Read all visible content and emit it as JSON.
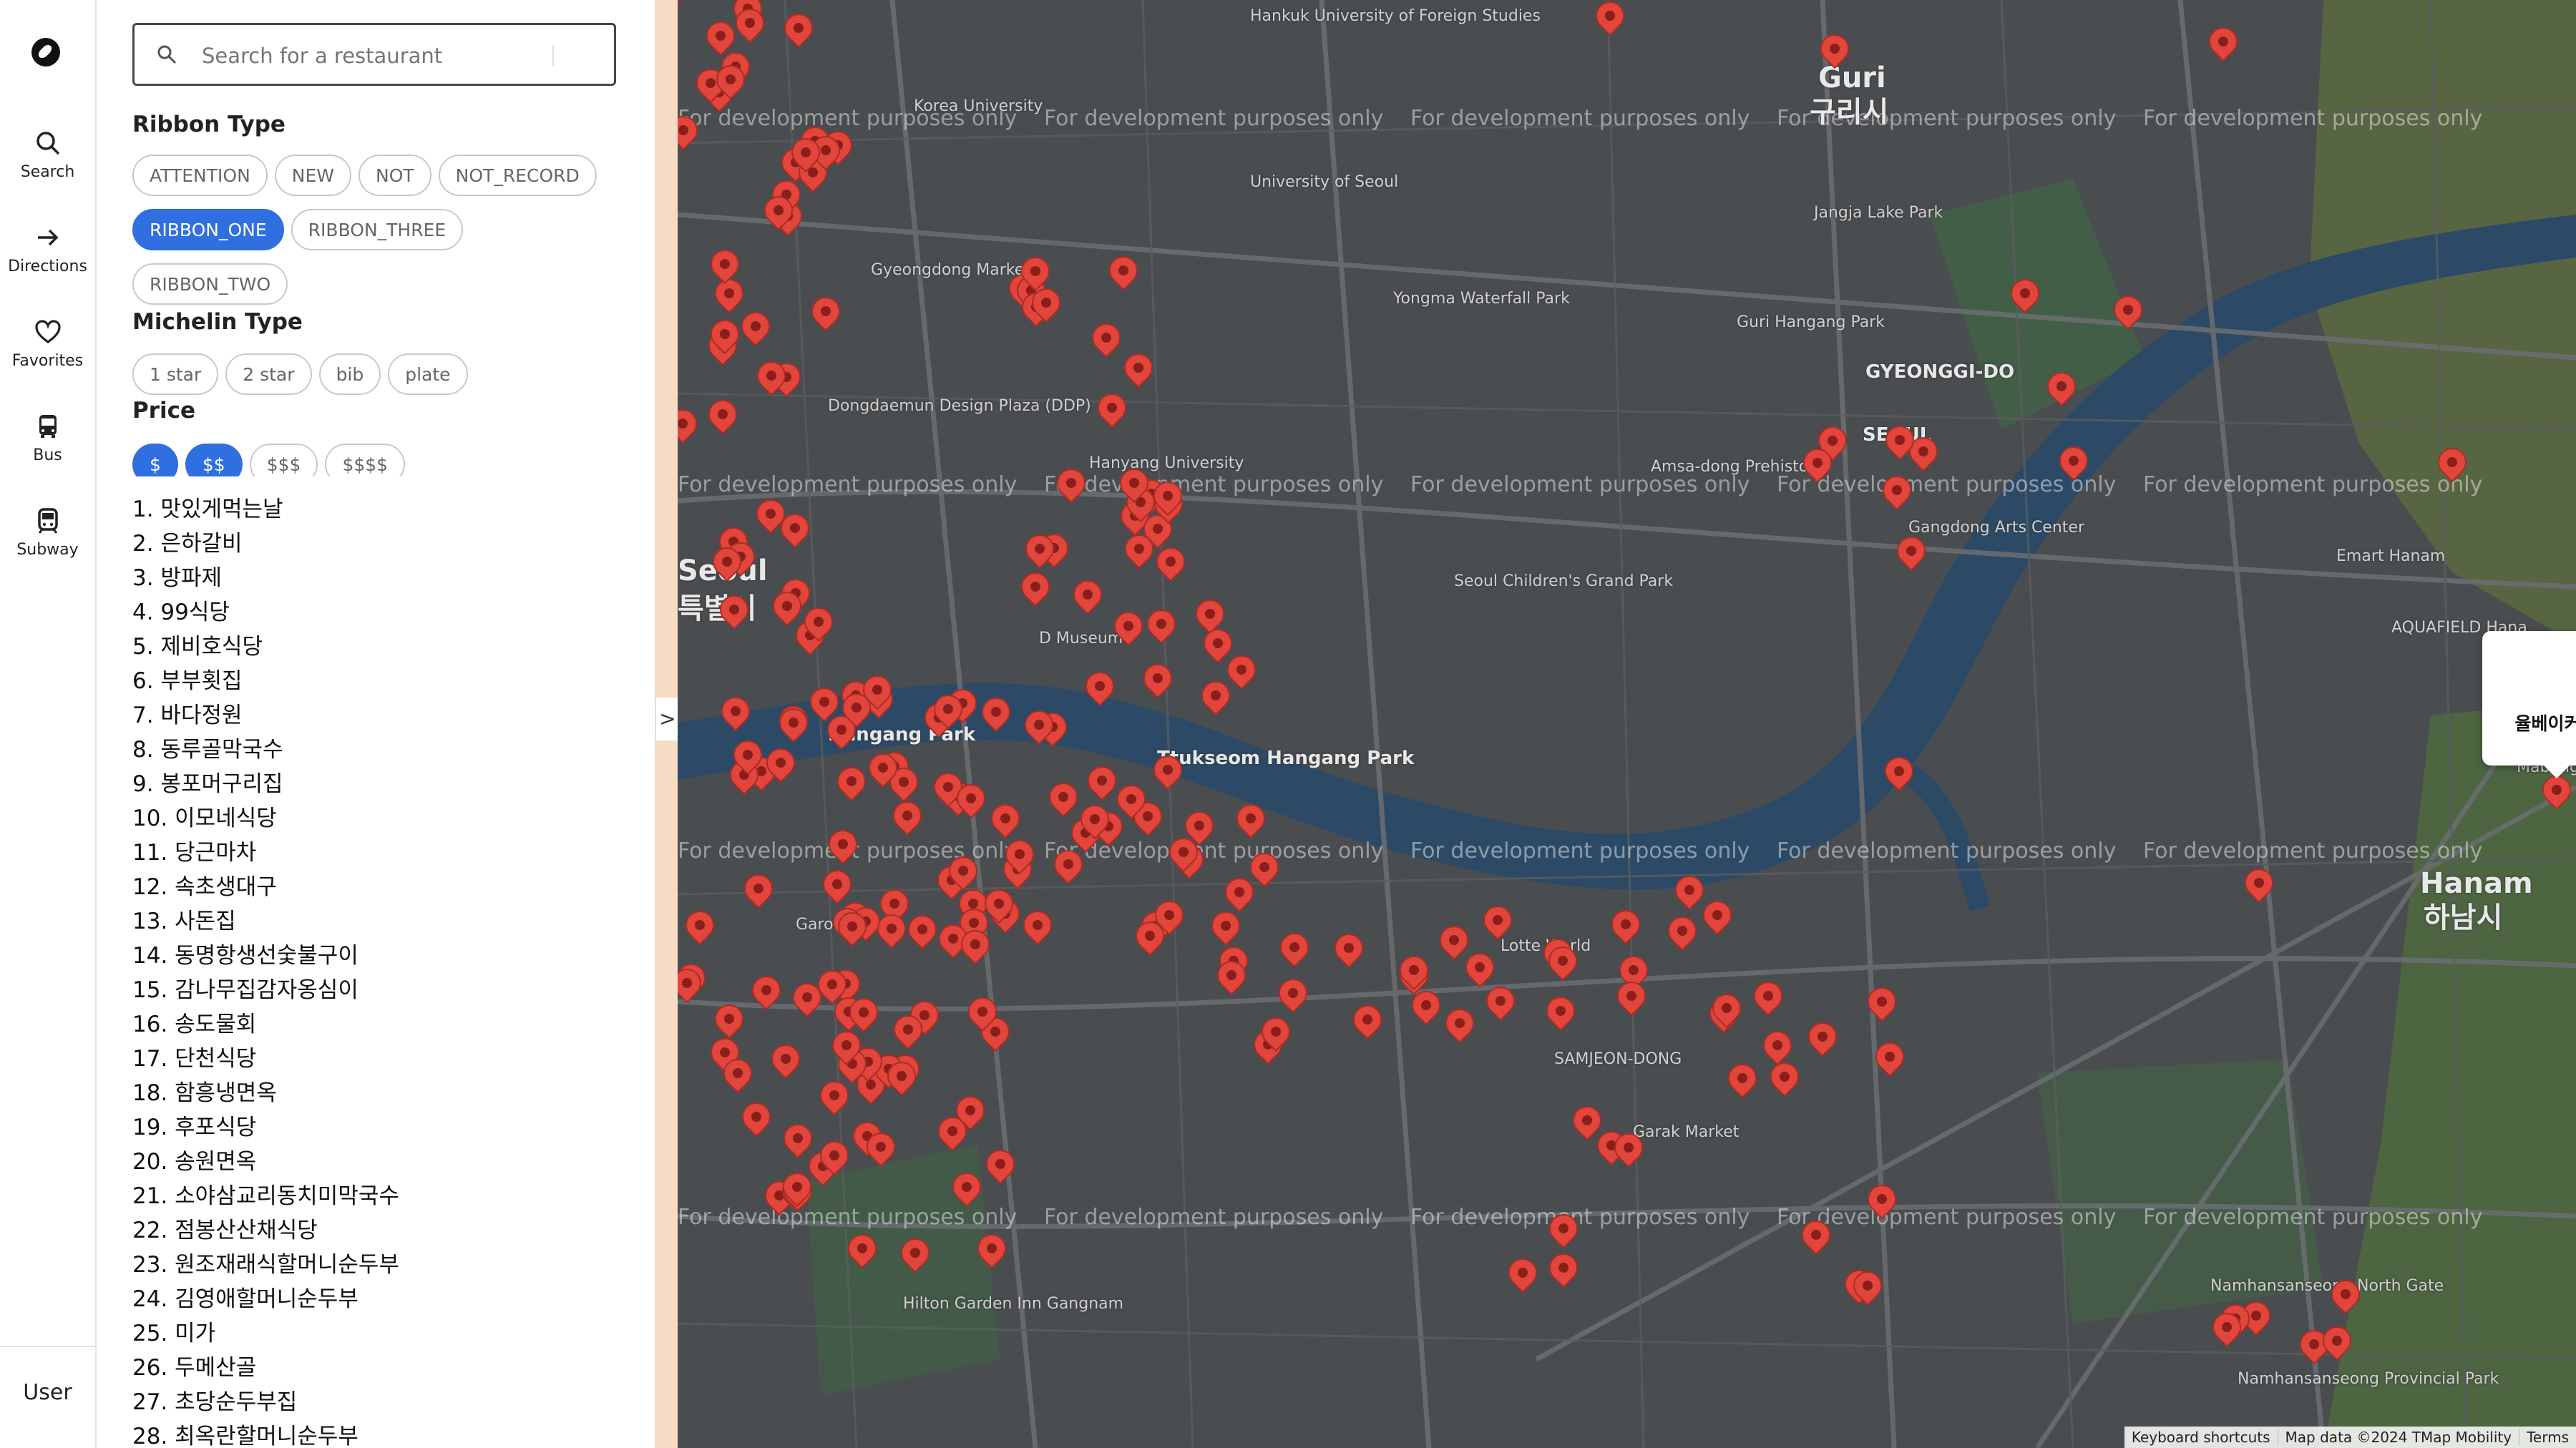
{
  "nav": {
    "logo_icon": "compass-logo-icon",
    "items": [
      {
        "label": "Search",
        "icon": "search-icon"
      },
      {
        "label": "Directions",
        "icon": "arrow-right-icon"
      },
      {
        "label": "Favorites",
        "icon": "heart-icon"
      },
      {
        "label": "Bus",
        "icon": "bus-icon"
      },
      {
        "label": "Subway",
        "icon": "subway-icon"
      }
    ],
    "user_label": "User"
  },
  "search": {
    "placeholder": "Search for a restaurant",
    "value": ""
  },
  "filters": {
    "ribbon": {
      "title": "Ribbon Type",
      "options": [
        {
          "label": "ATTENTION",
          "selected": false
        },
        {
          "label": "NEW",
          "selected": false
        },
        {
          "label": "NOT",
          "selected": false
        },
        {
          "label": "NOT_RECORD",
          "selected": false
        },
        {
          "label": "RIBBON_ONE",
          "selected": true
        },
        {
          "label": "RIBBON_THREE",
          "selected": false
        },
        {
          "label": "RIBBON_TWO",
          "selected": false
        }
      ]
    },
    "michelin": {
      "title": "Michelin Type",
      "options": [
        {
          "label": "1 star",
          "selected": false
        },
        {
          "label": "2 star",
          "selected": false
        },
        {
          "label": "bib",
          "selected": false
        },
        {
          "label": "plate",
          "selected": false
        }
      ]
    },
    "price": {
      "title": "Price",
      "options": [
        {
          "label": "$",
          "selected": true
        },
        {
          "label": "$$",
          "selected": true
        },
        {
          "label": "$$$",
          "selected": false
        },
        {
          "label": "$$$$",
          "selected": false
        }
      ]
    }
  },
  "restaurants": [
    "1. 맛있게먹는날",
    "2. 은하갈비",
    "3. 방파제",
    "4. 99식당",
    "5. 제비호식당",
    "6. 부부횟집",
    "7. 바다정원",
    "8. 동루골막국수",
    "9. 봉포머구리집",
    "10. 이모네식당",
    "11. 당근마차",
    "12. 속초생대구",
    "13. 사돈집",
    "14. 동명항생선숯불구이",
    "15. 감나무집감자옹심이",
    "16. 송도물회",
    "17. 단천식당",
    "18. 함흥냉면옥",
    "19. 후포식당",
    "20. 송원면옥",
    "21. 소야삼교리동치미막국수",
    "22. 점봉산산채식당",
    "23. 원조재래식할머니순두부",
    "24. 김영애할머니순두부",
    "25. 미가",
    "26. 두메산골",
    "27. 초당순두부집",
    "28. 최옥란할머니순두부"
  ],
  "panel_toggle": ">",
  "map": {
    "watermark": "For development purposes only",
    "popup": {
      "title": "율베이커리",
      "close_icon": "close-icon"
    },
    "zoom_in": "+",
    "zoom_out": "−",
    "attribution": [
      "Keyboard shortcuts",
      "Map data ©2024 TMap Mobility",
      "Terms"
    ],
    "labels": {
      "guri": "Guri",
      "guri_ko": "구리시",
      "seoul": "Seoul",
      "seoul_ko": "특별시",
      "hanam": "Hanam",
      "hanam_ko": "하남시",
      "tukseom": "Ttukseom Hangang Park",
      "hangang": "Hangang Park",
      "ddp": "Dongdaemun Design Plaza (DDP)",
      "univ_seoul": "University of Seoul",
      "hanyang": "Hanyang University",
      "lotte": "Lotte World",
      "garak": "Garak Market",
      "yongma": "Yongma Waterfall Park",
      "gyeongdong": "Gyeongdong Market",
      "children": "Seoul Children's Grand Park",
      "amsa": "Amsa-dong Prehistoric",
      "gangdong": "Gangdong Arts Center",
      "emart": "Emart Hanam",
      "aquafield": "AQUAFIELD Hana",
      "namhansan": "Namhansanseong North Gate",
      "namhansan_park": "Namhansanseong Provincial Park",
      "hilton": "Hilton Garden Inn Gangnam",
      "jangja": "Jangja Lake Park",
      "korea_univ": "Korea University",
      "hufs": "Hankuk University of Foreign Studies",
      "gyeonggi": "GYEONGGI-DO",
      "seoul_caps": "SEOUL",
      "mabangji": "Mabangji",
      "jamsil": "SAMJEON-DONG",
      "garosu": "Garosu-gil",
      "dmuseum": "D Museum",
      "guri_hangang": "Guri Hangang Park"
    },
    "colors": {
      "road": "#6a6d70",
      "river": "#2c4a66",
      "park": "#3f6a3f",
      "pin": "#e2453b",
      "hill": "#6b6a3e"
    }
  }
}
